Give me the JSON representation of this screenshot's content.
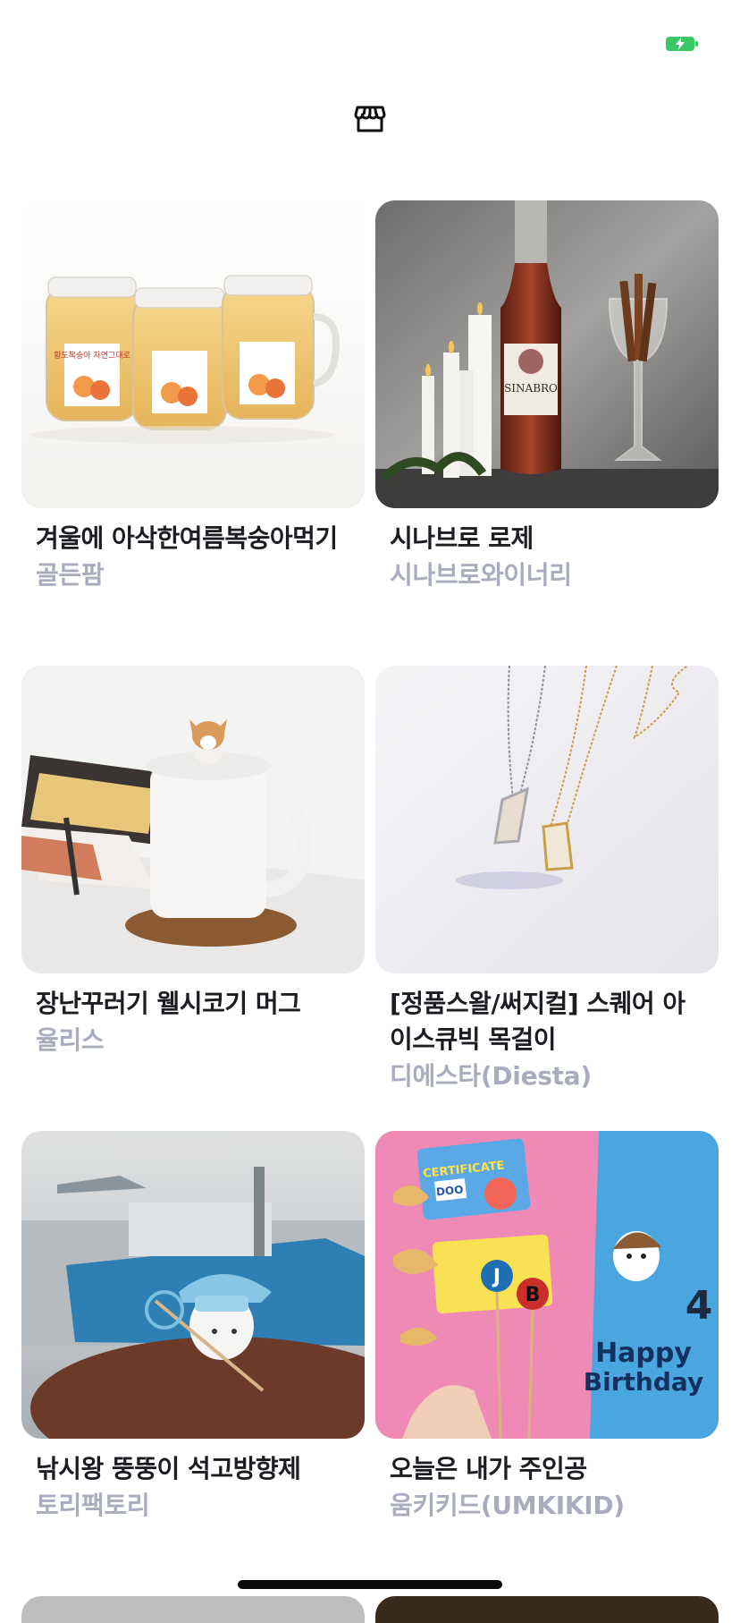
{
  "status_bar": {
    "battery": "charging"
  },
  "header": {
    "icon": "store-icon"
  },
  "products": [
    {
      "title": "겨울에 아삭한여름복숭아먹기",
      "seller": "골든팜"
    },
    {
      "title": "시나브로 로제",
      "seller": "시나브로와이너리"
    },
    {
      "title": "장난꾸러기 웰시코기 머그",
      "seller": "율리스"
    },
    {
      "title": "[정품스왈/써지컬] 스퀘어 아이스큐빅 목걸이",
      "seller": "디에스타(Diesta)"
    },
    {
      "title": "낚시왕 뚱뚱이 석고방향제",
      "seller": "토리팩토리"
    },
    {
      "title": "오늘은 내가 주인공",
      "seller": "움키키드(UMKIKID)"
    }
  ],
  "image_texts": {
    "wine_label": "SINABRO",
    "jar_label": "황도복숭아 자연그대로",
    "cert_label": "CERTIFICATE",
    "cert_name": "DOO",
    "letter_j": "J",
    "letter_b": "B",
    "happy": "Happy",
    "birthday": "Birthday",
    "number_4": "4"
  },
  "colors": {
    "accent_green": "#3cc766",
    "title": "#1c1c22",
    "seller": "#a8acbd"
  }
}
